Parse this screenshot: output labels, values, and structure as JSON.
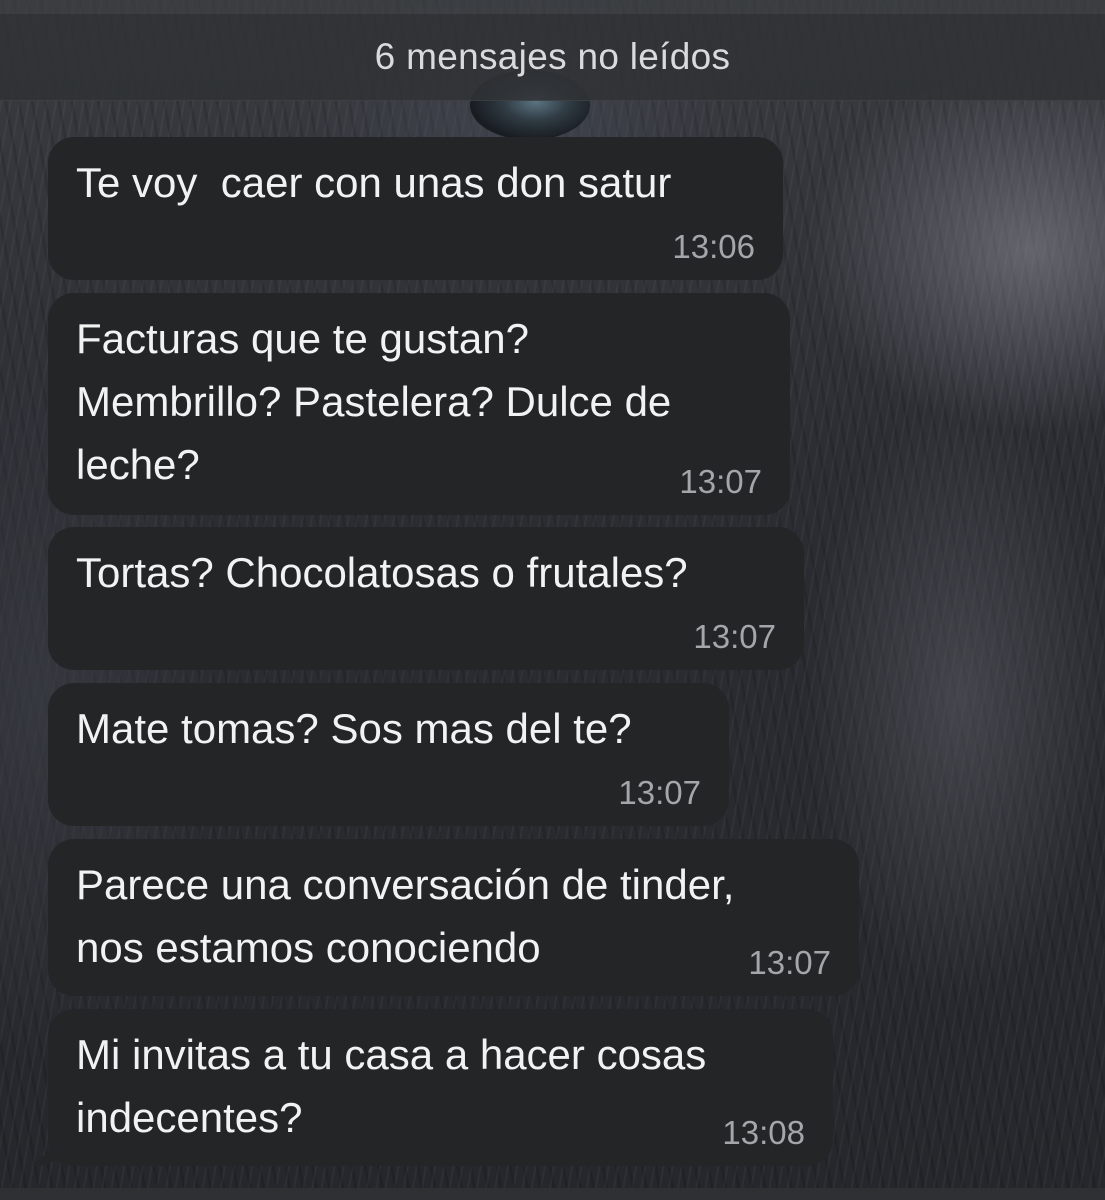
{
  "banner": {
    "unread": "6 mensajes no leídos"
  },
  "messages": [
    {
      "text": "Te voy  caer con unas don satur",
      "time": "13:06"
    },
    {
      "text": "Facturas que te gustan?\nMembrillo? Pastelera? Dulce de\nleche?",
      "time": "13:07"
    },
    {
      "text": "Tortas? Chocolatosas o frutales?",
      "time": "13:07"
    },
    {
      "text": "Mate tomas? Sos mas del te?",
      "time": "13:07"
    },
    {
      "text": "Parece una conversación de tinder,\nnos estamos conociendo",
      "time": "13:07"
    },
    {
      "text": "Mi invitas a tu casa a hacer cosas\nindecentes?",
      "time": "13:08"
    }
  ],
  "colors": {
    "bubble": "#232527",
    "time": "#a4a6a9",
    "text": "#f2f2f2"
  }
}
